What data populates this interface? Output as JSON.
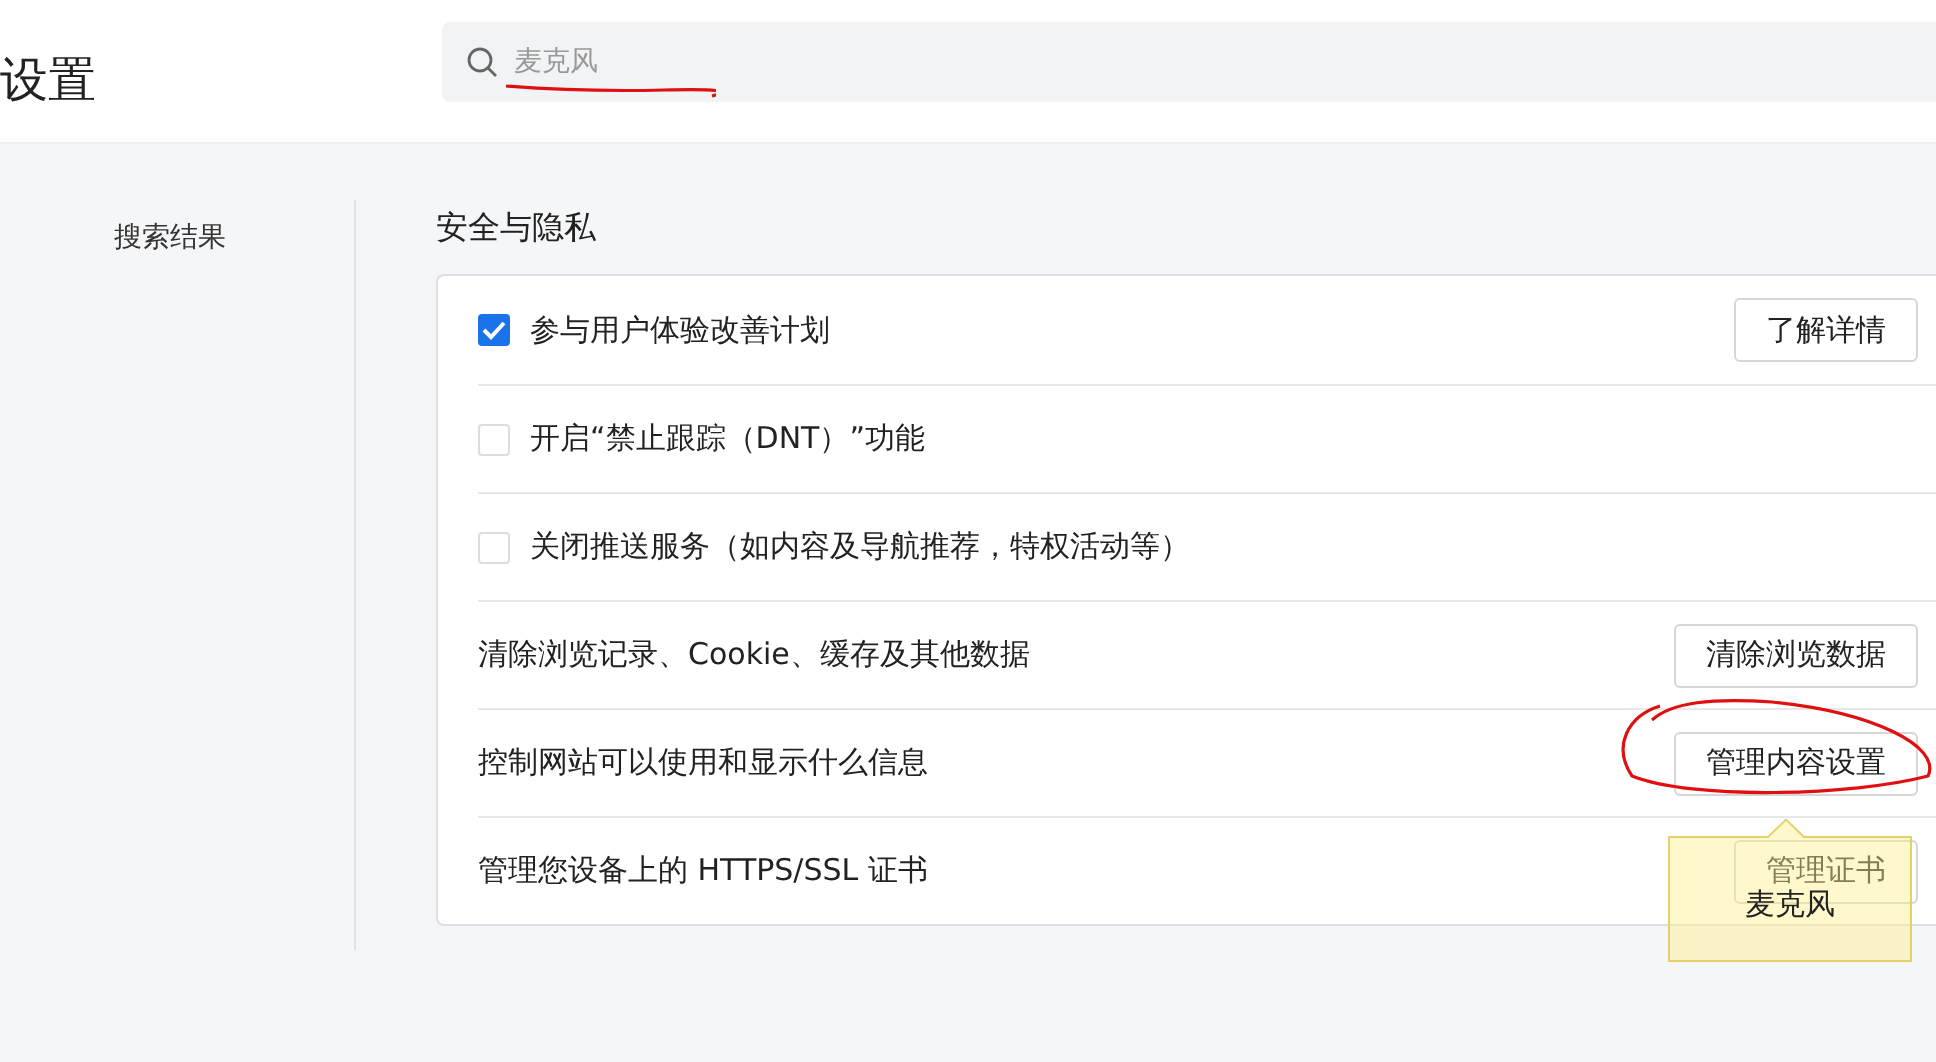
{
  "header": {
    "title": "设置",
    "search": {
      "value": "麦克风"
    }
  },
  "sidebar": {
    "items": [
      {
        "label": "搜索结果"
      }
    ]
  },
  "section": {
    "title": "安全与隐私",
    "rows": [
      {
        "kind": "checkbox",
        "label": "参与用户体验改善计划",
        "checked": true,
        "button": "了解详情"
      },
      {
        "kind": "checkbox",
        "label": "开启“禁止跟踪（DNT）”功能",
        "checked": false
      },
      {
        "kind": "checkbox",
        "label": "关闭推送服务（如内容及导航推荐，特权活动等）",
        "checked": false
      },
      {
        "kind": "action",
        "label": "清除浏览记录、Cookie、缓存及其他数据",
        "button": "清除浏览数据"
      },
      {
        "kind": "action",
        "label": "控制网站可以使用和显示什么信息",
        "button": "管理内容设置"
      },
      {
        "kind": "action",
        "label": "管理您设备上的 HTTPS/SSL 证书",
        "button": "管理证书"
      }
    ]
  },
  "tooltip": {
    "text": "麦克风"
  }
}
